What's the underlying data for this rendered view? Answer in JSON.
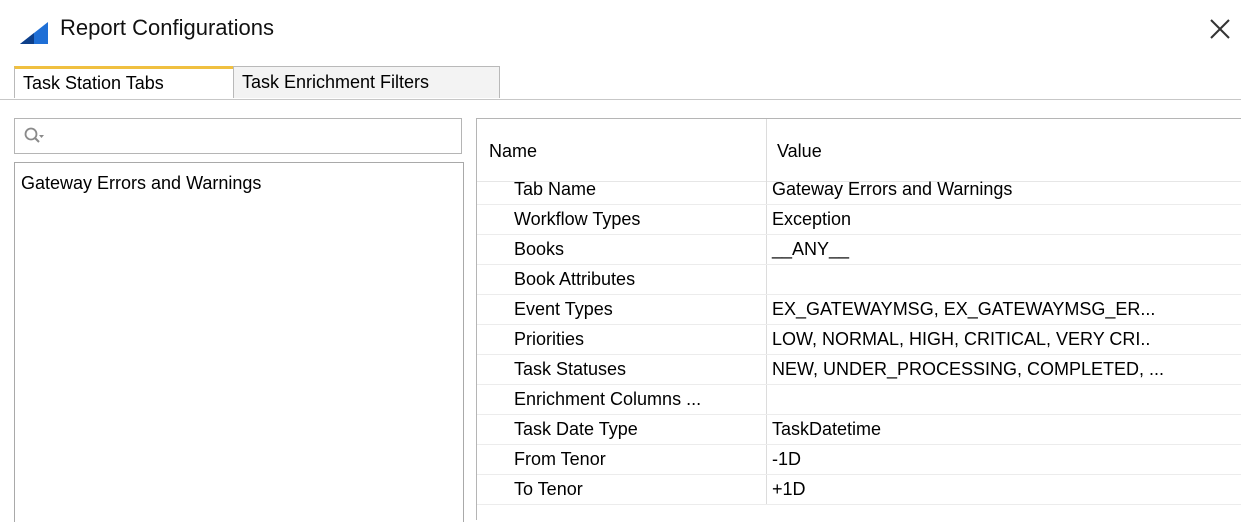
{
  "window": {
    "title": "Report Configurations",
    "icon": "app-logo-icon",
    "close_icon": "close-icon"
  },
  "tabs": [
    {
      "label": "Task Station Tabs",
      "active": true
    },
    {
      "label": "Task Enrichment Filters",
      "active": false
    }
  ],
  "left_panel": {
    "search": {
      "placeholder": "",
      "value": "",
      "icon": "search-icon"
    },
    "items": [
      "Gateway Errors and Warnings"
    ]
  },
  "properties": {
    "columns": {
      "name": "Name",
      "value": "Value"
    },
    "rows": [
      {
        "name": "Tab Name",
        "value": "Gateway Errors and Warnings"
      },
      {
        "name": "Workflow Types",
        "value": "Exception"
      },
      {
        "name": "Books",
        "value": "__ANY__"
      },
      {
        "name": "Book Attributes",
        "value": ""
      },
      {
        "name": "Event Types",
        "value": "EX_GATEWAYMSG, EX_GATEWAYMSG_ER..."
      },
      {
        "name": "Priorities",
        "value": "LOW, NORMAL, HIGH, CRITICAL, VERY CRI.."
      },
      {
        "name": "Task Statuses",
        "value": "NEW, UNDER_PROCESSING, COMPLETED, ..."
      },
      {
        "name": "Enrichment Columns ...",
        "value": ""
      },
      {
        "name": "Task Date Type",
        "value": "TaskDatetime"
      },
      {
        "name": "From Tenor",
        "value": "-1D"
      },
      {
        "name": "To Tenor",
        "value": "+1D"
      }
    ]
  },
  "colors": {
    "active_tab_accent": "#f0c040",
    "logo_blue": "#1f6fd6"
  }
}
